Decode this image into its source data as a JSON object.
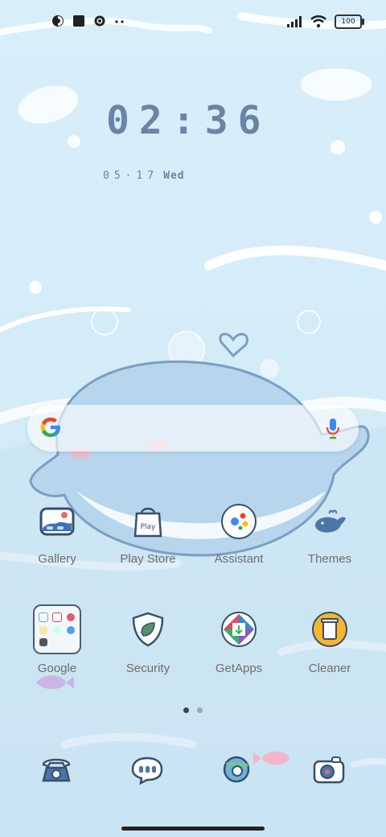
{
  "status_bar": {
    "left_icons": [
      "data-saver-icon",
      "stop-icon",
      "settings-icon",
      "more-dots-icon"
    ],
    "right_icons": [
      "signal-icon",
      "wifi-icon",
      "battery-icon"
    ],
    "battery_level": "100"
  },
  "clock": {
    "time": "02:36",
    "date": "05·17",
    "weekday": "Wed"
  },
  "search": {
    "logo_icon": "google-g-icon",
    "mic_icon": "mic-icon"
  },
  "apps_row1": [
    {
      "label": "Gallery"
    },
    {
      "label": "Play Store"
    },
    {
      "label": "Assistant"
    },
    {
      "label": "Themes"
    }
  ],
  "apps_row2": [
    {
      "label": "Google"
    },
    {
      "label": "Security"
    },
    {
      "label": "GetApps"
    },
    {
      "label": "Cleaner"
    }
  ],
  "page_indicator": {
    "pages": 2,
    "current": 1
  },
  "dock": [
    "phone-icon",
    "messages-icon",
    "browser-icon",
    "camera-icon"
  ]
}
